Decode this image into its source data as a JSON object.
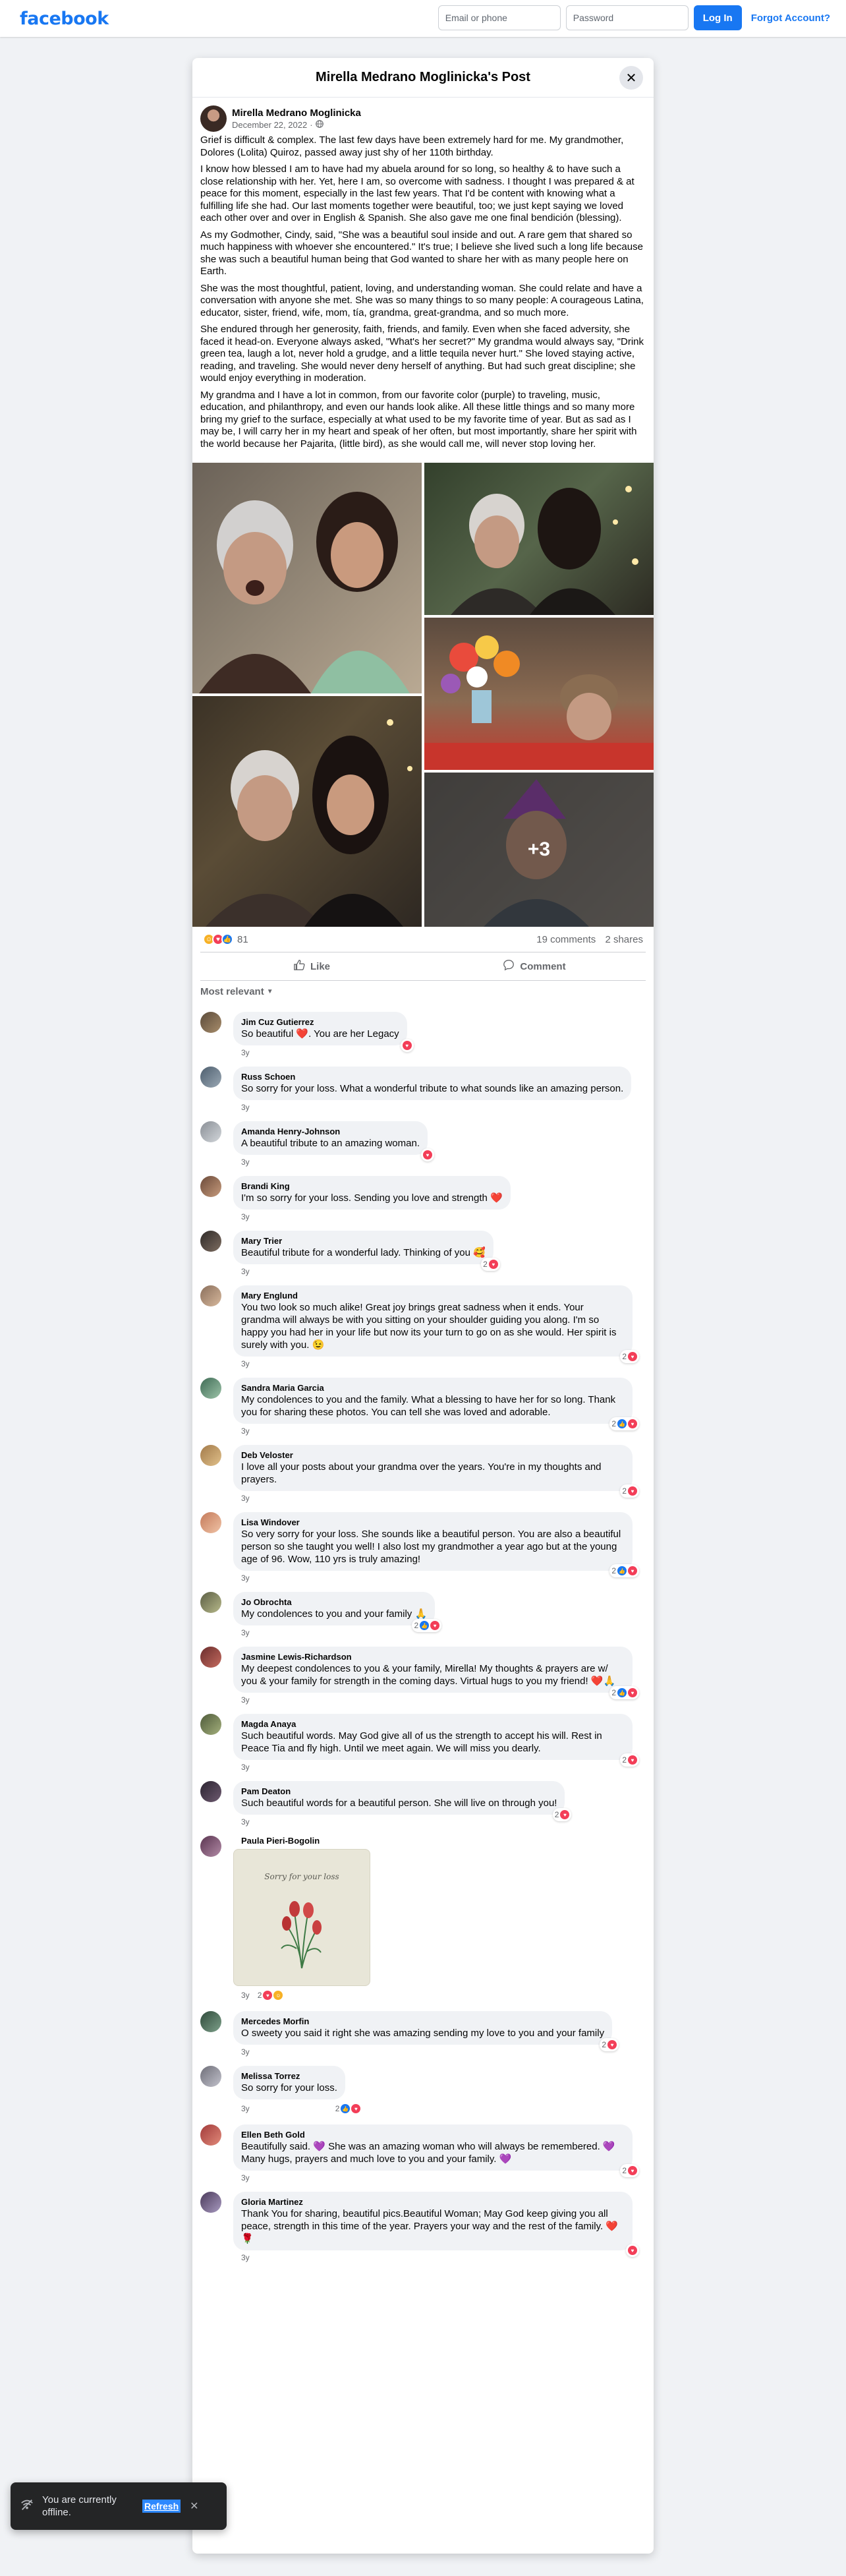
{
  "header": {
    "logo": "facebook",
    "email_placeholder": "Email or phone",
    "password_placeholder": "Password",
    "login_label": "Log In",
    "forgot_label": "Forgot Account?"
  },
  "dialog": {
    "title": "Mirella Medrano Moglinicka's Post"
  },
  "post": {
    "author": "Mirella Medrano Moglinicka",
    "date": "December 22, 2022",
    "paragraphs": [
      "Grief is difficult & complex. The last few days have been extremely hard for me. My grandmother, Dolores (Lolita) Quiroz, passed away just shy of her 110th birthday.",
      "I know how blessed I am to have had my abuela around for so long, so healthy & to have such a close relationship with her. Yet, here I am, so overcome with sadness. I thought I was prepared & at peace for this moment, especially in the last few years. That I'd be content with knowing what a fulfilling life she had. Our last moments together were beautiful, too; we just kept saying we loved each other over and over in English & Spanish. She also gave me one final bendición (blessing).",
      "As my Godmother, Cindy, said, \"She was a beautiful soul inside and out. A rare gem that shared so much happiness with whoever she encountered.\" It's true; I believe she lived such a long life because she was such a beautiful human being that God wanted to share her with as many people here on Earth.",
      "She was the most thoughtful, patient, loving, and understanding woman. She could relate and have a conversation with anyone she met. She was so many things to so many people: A courageous Latina, educator, sister, friend, wife, mom, tía, grandma, great-grandma, and so much more.",
      "She endured through her generosity, faith, friends, and family. Even when she faced adversity, she faced it head-on. Everyone always asked, \"What's her secret?\" My grandma would always say, \"Drink green tea, laugh a lot, never hold a grudge, and a little tequila never hurt.\" She loved staying active, reading, and traveling.  She would never deny herself of anything. But had such great discipline; she would enjoy everything in moderation.",
      "My grandma and I have a lot in common, from our favorite color (purple) to traveling, music, education, and philanthropy, and even our hands look alike. All these little things and so many more bring my grief to the surface, especially at what used to be my favorite time of year. But as sad as I may be, I will carry her in my heart and speak of her often, but most importantly, share her spirit with the world because her Pajarita, (little bird), as she would call me, will never stop loving her."
    ],
    "more_photos": "+3",
    "reaction_count": "81",
    "comments_count": "19 comments",
    "shares_count": "2 shares",
    "like_label": "Like",
    "comment_label": "Comment",
    "sort_label": "Most relevant"
  },
  "comments": [
    {
      "name": "Jim Cuz Gutierrez",
      "text": "So beautiful ❤️. You are her Legacy",
      "time": "3y",
      "reactions": ""
    },
    {
      "name": "Russ Schoen",
      "text": "So sorry for your loss. What a wonderful tribute to what sounds like an amazing person.",
      "time": "3y",
      "reactions": ""
    },
    {
      "name": "Amanda Henry-Johnson",
      "text": "A beautiful tribute to an amazing woman.",
      "time": "3y",
      "reactions": ""
    },
    {
      "name": "Brandi King",
      "text": "I'm so sorry for your loss. Sending you love and strength ❤️",
      "time": "3y",
      "reactions": ""
    },
    {
      "name": "Mary Trier",
      "text": "Beautiful tribute for a wonderful lady. Thinking of you 🥰",
      "time": "3y",
      "reactions": "2"
    },
    {
      "name": "Mary Englund",
      "text": "You two look so much alike! Great joy brings great sadness when it ends. Your grandma will always be with you sitting on your shoulder guiding you along. I'm so happy you had her in your life but now its your turn to go on as she would. Her spirit is surely with you. 😉",
      "time": "3y",
      "reactions": "2"
    },
    {
      "name": "Sandra Maria Garcia",
      "text": "My condolences to you and the family. What a blessing to have her for so long. Thank you for sharing these photos. You can tell she was loved and adorable.",
      "time": "3y",
      "reactions": "2"
    },
    {
      "name": "Deb Veloster",
      "text": "I love all your posts about your grandma over the years. You're in my thoughts and prayers.",
      "time": "3y",
      "reactions": "2"
    },
    {
      "name": "Lisa Windover",
      "text": "So very sorry for your loss. She sounds like a beautiful person. You are also a beautiful person so she taught you well! I also lost my grandmother a year ago but at the young age of 96. Wow, 110 yrs is truly amazing!",
      "time": "3y",
      "reactions": "2"
    },
    {
      "name": "Jo Obrochta",
      "text": "My condolences to you and your family 🙏",
      "time": "3y",
      "reactions": "2"
    },
    {
      "name": "Jasmine Lewis-Richardson",
      "text": "My deepest condolences to you & your family, Mirella! My thoughts & prayers are w/ you & your family for strength in the coming days. Virtual hugs to you my friend! ❤️🙏",
      "time": "3y",
      "reactions": "2"
    },
    {
      "name": "Magda Anaya",
      "text": "Such beautiful words. May God give all of us the strength to accept his will. Rest in Peace Tia and fly high. Until we meet again. We will miss you dearly.",
      "time": "3y",
      "reactions": "2"
    },
    {
      "name": "Pam Deaton",
      "text": "Such beautiful words for a beautiful person. She will live on through you!",
      "time": "3y",
      "reactions": "2"
    },
    {
      "name": "Paula Pieri-Bogolin",
      "text": "",
      "time": "3y",
      "reactions": "2",
      "sticker_text": "Sorry for your loss"
    },
    {
      "name": "Mercedes Morfin",
      "text": "O sweety you said it right she was amazing sending my love to you and your family",
      "time": "3y",
      "reactions": "2"
    },
    {
      "name": "Melissa Torrez",
      "text": "So sorry for your loss.",
      "time": "3y",
      "reactions": "2"
    },
    {
      "name": "Ellen Beth Gold",
      "text": "Beautifully said. 💜 She was an amazing woman who will always be remembered. 💜 Many hugs, prayers and much love to you and your family. 💜",
      "time": "3y",
      "reactions": "2"
    },
    {
      "name": "Gloria Martinez",
      "text": "Thank You for sharing, beautiful pics.Beautiful Woman; May God keep giving you all peace, strength in this time of the year. Prayers your way and the rest of the family. ❤️🌹",
      "time": "3y",
      "reactions": ""
    }
  ],
  "toast": {
    "text": "You are currently offline.",
    "refresh_label": "Refresh"
  },
  "colors": {
    "brand": "#1877f2",
    "like": "#1877f2",
    "love": "#f33e58",
    "care": "#f7b125"
  }
}
